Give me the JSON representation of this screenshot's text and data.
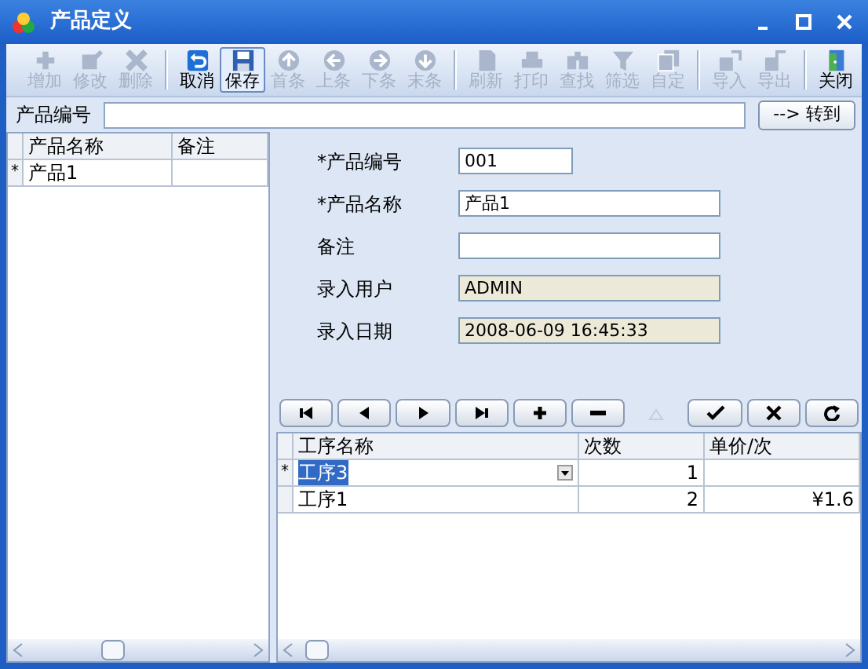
{
  "window": {
    "title": "产品定义"
  },
  "toolbar": {
    "groups": [
      [
        {
          "label": "增加",
          "kind": "add",
          "disabled": true,
          "hovered": false
        },
        {
          "label": "修改",
          "kind": "edit",
          "disabled": true,
          "hovered": false
        },
        {
          "label": "删除",
          "kind": "delete",
          "disabled": true,
          "hovered": false
        }
      ],
      [
        {
          "label": "取消",
          "kind": "undo",
          "disabled": false,
          "hovered": false
        },
        {
          "label": "保存",
          "kind": "save",
          "disabled": false,
          "hovered": true
        },
        {
          "label": "首条",
          "kind": "up",
          "disabled": true,
          "hovered": false
        },
        {
          "label": "上条",
          "kind": "left",
          "disabled": true,
          "hovered": false
        },
        {
          "label": "下条",
          "kind": "right",
          "disabled": true,
          "hovered": false
        },
        {
          "label": "末条",
          "kind": "down",
          "disabled": true,
          "hovered": false
        }
      ],
      [
        {
          "label": "刷新",
          "kind": "page",
          "disabled": true,
          "hovered": false
        },
        {
          "label": "打印",
          "kind": "print",
          "disabled": true,
          "hovered": false
        },
        {
          "label": "查找",
          "kind": "find",
          "disabled": true,
          "hovered": false
        },
        {
          "label": "筛选",
          "kind": "filter",
          "disabled": true,
          "hovered": false
        },
        {
          "label": "自定",
          "kind": "pages",
          "disabled": true,
          "hovered": false
        }
      ],
      [
        {
          "label": "导入",
          "kind": "import",
          "disabled": true,
          "hovered": false
        },
        {
          "label": "导出",
          "kind": "export",
          "disabled": true,
          "hovered": false
        }
      ],
      [
        {
          "label": "关闭",
          "kind": "door",
          "disabled": false,
          "hovered": false
        }
      ]
    ]
  },
  "search": {
    "label": "产品编号",
    "button": "--> 转到"
  },
  "product_grid": {
    "columns": [
      "产品名称",
      "备注"
    ],
    "rows": [
      {
        "marker": "*",
        "cells": [
          "产品1",
          ""
        ]
      }
    ]
  },
  "form": {
    "fields": [
      {
        "label": "*产品编号",
        "value": "001",
        "readonly": false,
        "kind": "short"
      },
      {
        "label": "*产品名称",
        "value": "产品1",
        "readonly": false,
        "kind": "long"
      },
      {
        "label": "备注",
        "readonly": false,
        "kind": "long"
      },
      {
        "label": "录入用户",
        "value": "ADMIN",
        "readonly": true,
        "kind": "long"
      },
      {
        "label": "录入日期",
        "value": "2008-06-09 16:45:33",
        "readonly": true,
        "kind": "long"
      }
    ]
  },
  "navigator": {
    "buttons": [
      {
        "kind": "first",
        "disabled": false
      },
      {
        "kind": "prior",
        "disabled": false
      },
      {
        "kind": "next",
        "disabled": false
      },
      {
        "kind": "last",
        "disabled": false
      },
      {
        "kind": "insert",
        "disabled": false
      },
      {
        "kind": "delete",
        "disabled": false
      },
      {
        "kind": "edit",
        "disabled": true
      },
      {
        "kind": "post",
        "disabled": false
      },
      {
        "kind": "cancel",
        "disabled": false
      },
      {
        "kind": "refresh",
        "disabled": false
      }
    ]
  },
  "process_grid": {
    "columns": [
      "工序名称",
      "次数",
      "单价/次"
    ],
    "rows": [
      {
        "marker": "*",
        "editing": true,
        "cells": [
          "工序3",
          "1",
          ""
        ]
      },
      {
        "marker": "",
        "editing": false,
        "cells": [
          "工序1",
          "2",
          "¥1.6"
        ]
      }
    ]
  }
}
